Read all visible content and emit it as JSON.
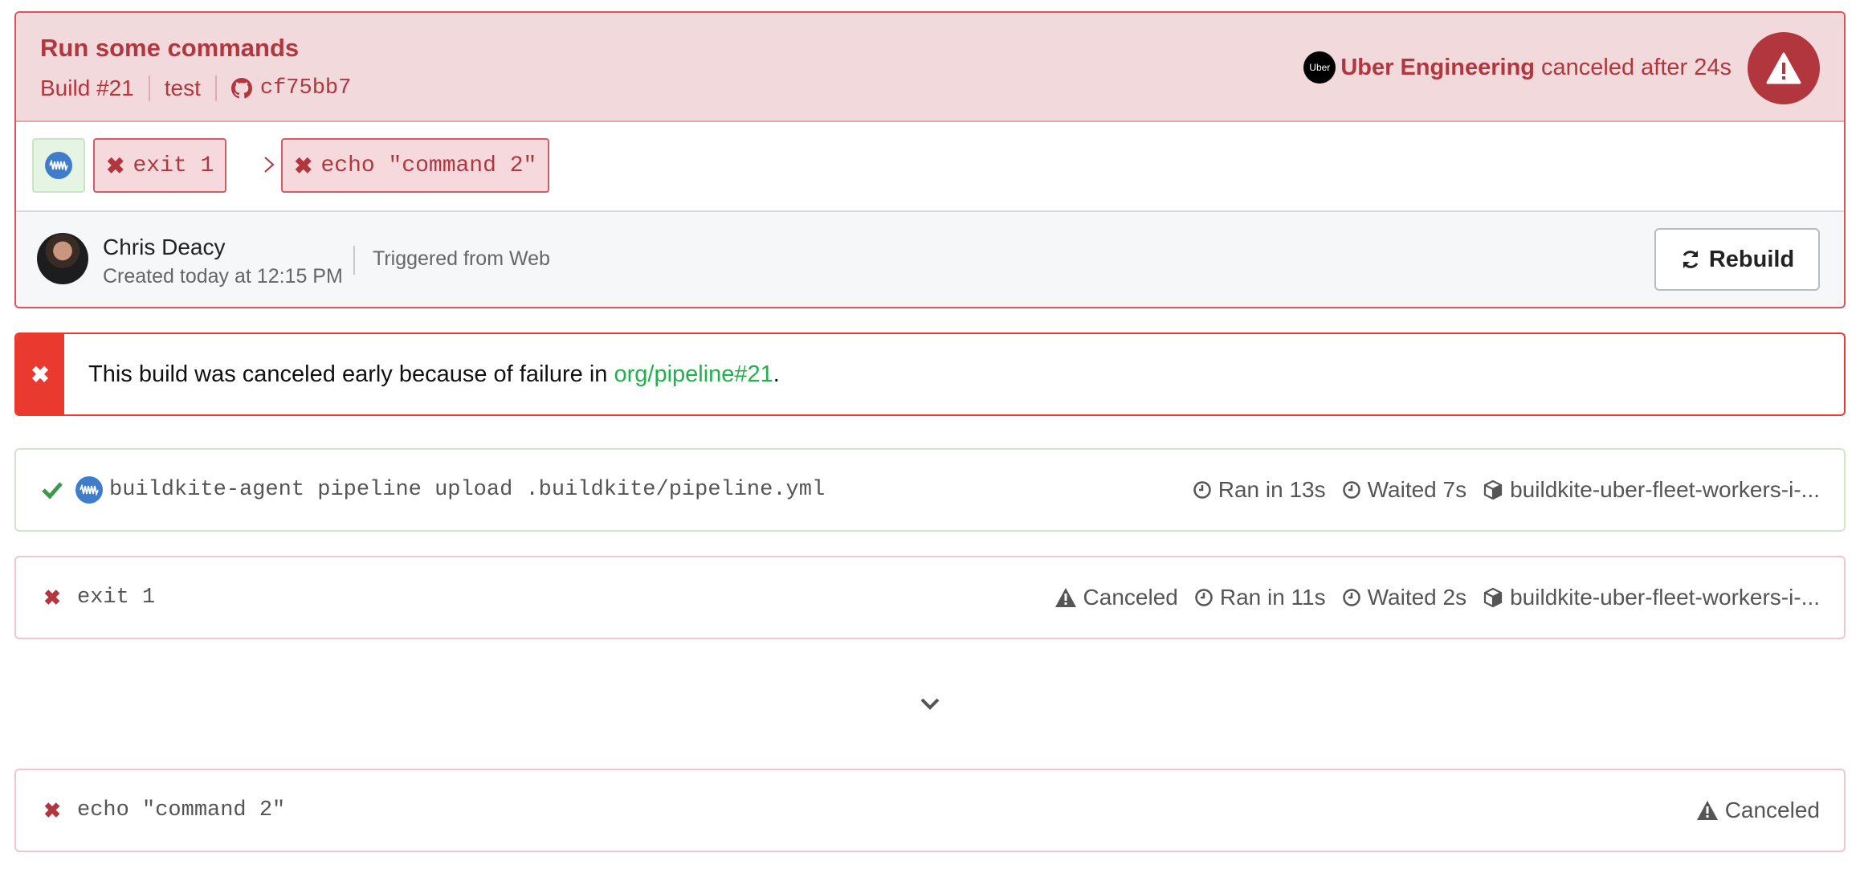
{
  "build": {
    "title": "Run some commands",
    "number": "Build #21",
    "branch": "test",
    "commit": "cf75bb7",
    "org_badge": "Uber",
    "org_name": "Uber Engineering",
    "status_text": "canceled after 24s",
    "colors": {
      "failure": "#b1363d",
      "failure_bg": "#f2d9dc",
      "success": "#20b14c",
      "alert": "#ea3a2f"
    }
  },
  "pipeline_steps": [
    {
      "icon": "buildkite-agent-icon",
      "state": "passed"
    },
    {
      "label": "exit 1",
      "state": "failed"
    },
    {
      "label": "echo \"command 2\"",
      "state": "failed"
    }
  ],
  "author": {
    "name": "Chris Deacy",
    "created": "Created today at 12:15 PM",
    "trigger": "Triggered from Web",
    "rebuild_label": "Rebuild"
  },
  "alert": {
    "text_before": "This build was canceled early because of failure in ",
    "link_text": "org/pipeline#21",
    "text_after": "."
  },
  "jobs": [
    {
      "state": "passed",
      "command": "buildkite-agent pipeline upload .buildkite/pipeline.yml",
      "ran": "Ran in 13s",
      "waited": "Waited 7s",
      "agent": "buildkite-uber-fleet-workers-i-..."
    },
    {
      "state": "failed",
      "command": "exit 1",
      "status": "Canceled",
      "ran": "Ran in 11s",
      "waited": "Waited 2s",
      "agent": "buildkite-uber-fleet-workers-i-..."
    },
    {
      "state": "failed",
      "command": "echo \"command 2\"",
      "status": "Canceled"
    }
  ]
}
